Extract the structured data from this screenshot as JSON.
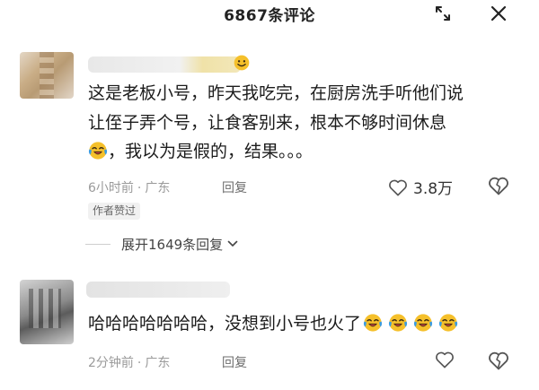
{
  "header": {
    "title": "6867条评论",
    "expand_icon": "expand-icon",
    "close_icon": "close-icon"
  },
  "comments": [
    {
      "lines": [
        "这是老板小号，昨天我吃完，在厨房洗手听他们说",
        "让侄子弄个号，让食客别来，根本不够时间休息",
        "，我以为是假的，结果。。。"
      ],
      "time": "6小时前",
      "location": "广东",
      "reply_label": "回复",
      "like_count": "3.8万",
      "badge": "作者赞过",
      "expand_label": "展开1649条回复"
    },
    {
      "lines": [
        "哈哈哈哈哈哈哈，没想到小号也火了"
      ],
      "time": "2分钟前",
      "location": "广东",
      "reply_label": "回复"
    }
  ],
  "meta_separator": "·",
  "colors": {
    "emoji_face": "#f5c02b",
    "tears": "#3b9be0",
    "text": "#1c1c1c",
    "meta": "#9a9a9a"
  }
}
